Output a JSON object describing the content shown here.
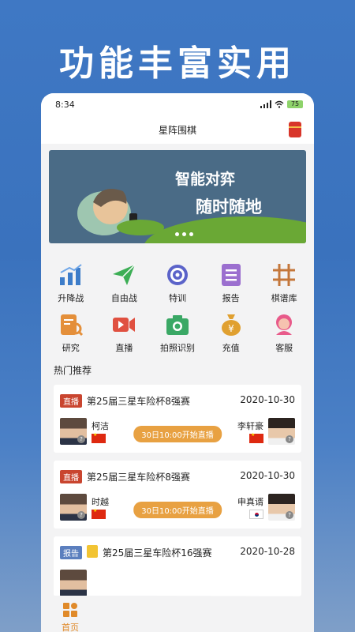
{
  "headline": "功能丰富实用",
  "status": {
    "time": "8:34",
    "battery": "75"
  },
  "app_title": "星阵围棋",
  "banner": {
    "line1": "智能对弈",
    "line2": "随时随地"
  },
  "grid": [
    {
      "label": "升降战",
      "icon": "bar-chart-icon",
      "color": "#3d7cc9"
    },
    {
      "label": "自由战",
      "icon": "paper-plane-icon",
      "color": "#3cae55"
    },
    {
      "label": "特训",
      "icon": "target-icon",
      "color": "#5b63c9"
    },
    {
      "label": "报告",
      "icon": "report-icon",
      "color": "#9b6fcf"
    },
    {
      "label": "棋谱库",
      "icon": "grid-board-icon",
      "color": "#c4773b"
    },
    {
      "label": "研究",
      "icon": "research-icon",
      "color": "#e48f3a"
    },
    {
      "label": "直播",
      "icon": "video-icon",
      "color": "#e05040"
    },
    {
      "label": "拍照识别",
      "icon": "camera-icon",
      "color": "#3aa865"
    },
    {
      "label": "充值",
      "icon": "money-bag-icon",
      "color": "#e0a030"
    },
    {
      "label": "客服",
      "icon": "support-icon",
      "color": "#e85a8a"
    }
  ],
  "section_title": "热门推荐",
  "matches": [
    {
      "tag": "直播",
      "title": "第25届三星车险杯8强赛",
      "date": "2020-10-30",
      "left_player": "柯洁",
      "right_player": "李轩豪",
      "pill": "30日10:00开始直播",
      "right_flag": "cn"
    },
    {
      "tag": "直播",
      "title": "第25届三星车险杯8强赛",
      "date": "2020-10-30",
      "left_player": "时越",
      "right_player": "申真谞",
      "pill": "30日10:00开始直播",
      "right_flag": "kr"
    },
    {
      "tag": "报告",
      "title": "第25届三星车险杯16强赛",
      "date": "2020-10-28"
    }
  ],
  "tab": {
    "home": "首页"
  },
  "colors": {
    "accent": "#e08a2a",
    "live": "#c9452f",
    "report": "#5b7fbe"
  }
}
